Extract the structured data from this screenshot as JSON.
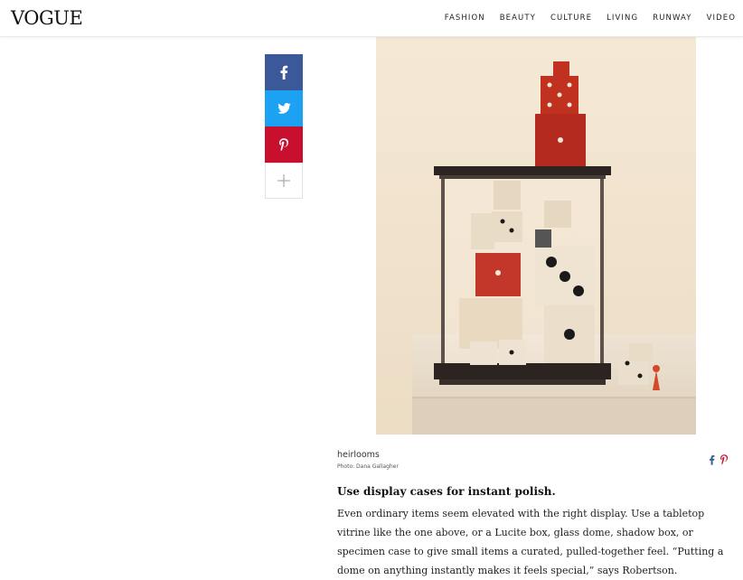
{
  "header": {
    "logo": "VOGUE",
    "nav": [
      "FASHION",
      "BEAUTY",
      "CULTURE",
      "LIVING",
      "RUNWAY",
      "VIDEO"
    ]
  },
  "share_rail": {
    "icons": [
      "facebook-icon",
      "twitter-icon",
      "pinterest-icon",
      "plus-icon"
    ],
    "colors": {
      "facebook": "#3b5998",
      "twitter": "#1da1f2",
      "pinterest": "#c8102e"
    }
  },
  "figure": {
    "caption": "heirlooms",
    "credit": "Photo: Dana Gallagher"
  },
  "article": {
    "lede": "Use display cases for instant polish.",
    "body": "Even ordinary items seem elevated with the right display. Use a tabletop vitrine like the one above, or a Lucite box, glass dome, shadow box, or specimen case to give small items a curated, pulled-together feel. “Putting a dome on anything instantly makes it feels special,” says Robertson."
  }
}
